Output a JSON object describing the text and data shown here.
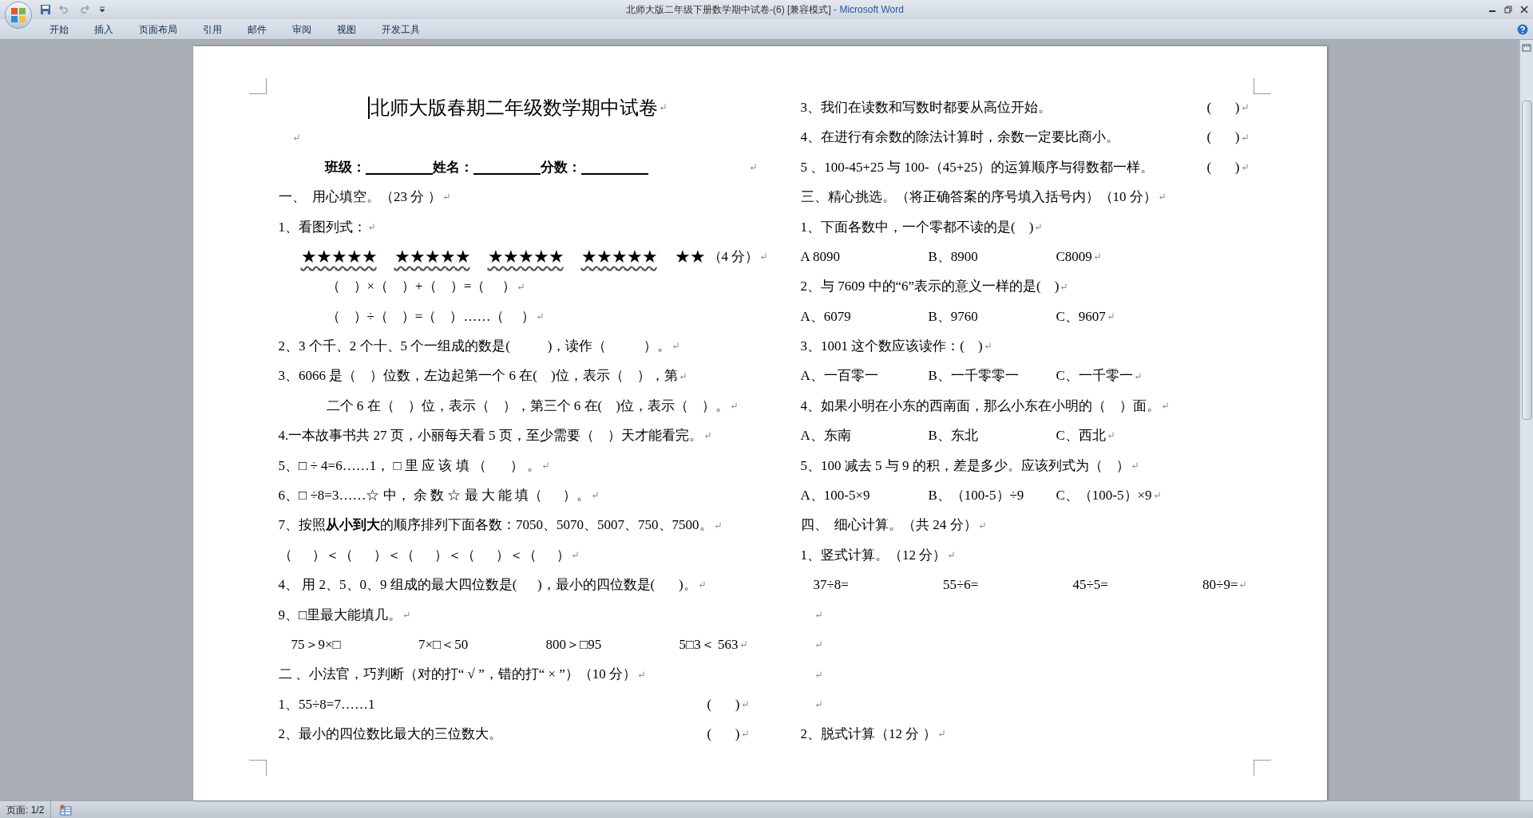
{
  "window": {
    "document_title": "北师大版二年级下册数学期中试卷-(6) [兼容模式]",
    "app_title": " - Microsoft Word"
  },
  "ribbon_tabs": [
    {
      "label": "开始",
      "selected": false
    },
    {
      "label": "插入",
      "selected": false
    },
    {
      "label": "页面布局",
      "selected": false
    },
    {
      "label": "引用",
      "selected": false
    },
    {
      "label": "邮件",
      "selected": false
    },
    {
      "label": "审阅",
      "selected": false
    },
    {
      "label": "视图",
      "selected": false
    },
    {
      "label": "开发工具",
      "selected": false
    }
  ],
  "document": {
    "left_column": [
      {
        "kind": "title",
        "text": "北师大版春期二年级数学期中试卷"
      },
      {
        "kind": "blank"
      },
      {
        "kind": "fields",
        "fields": [
          {
            "label": "班级："
          },
          {
            "label": "姓名："
          },
          {
            "label": "分数："
          }
        ]
      },
      {
        "kind": "text",
        "text": "一、  用心填空。（23 分 ）"
      },
      {
        "kind": "text",
        "text": "1、看图列式："
      },
      {
        "kind": "stars",
        "groups": [
          {
            "text": "★★★★★",
            "flagged": true
          },
          {
            "text": "★★★★★",
            "flagged": true
          },
          {
            "text": "★★★★★",
            "flagged": true
          },
          {
            "text": "★★★★★",
            "flagged": true
          },
          {
            "text": "★★",
            "flagged": false
          }
        ],
        "note": "（4 分）"
      },
      {
        "kind": "indented",
        "text": "（    ）×（    ）+（    ）=（     ）"
      },
      {
        "kind": "indented",
        "text": "（    ）÷（    ）=（    ）……（     ）"
      },
      {
        "kind": "text",
        "text": "2、3 个千、2 个十、5 个一组成的数是(           )，读作（           ）。"
      },
      {
        "kind": "text",
        "text": "3、6066 是（    ）位数，左边起第一个 6 在(    )位，表示（    ），第"
      },
      {
        "kind": "indented",
        "text": "二个 6 在（    ）位，表示（    ），第三个 6 在(    )位，表示（    ）。"
      },
      {
        "kind": "text",
        "text": "4.一本故事书共 27 页，小丽每天看 5 页，至少需要（    ）天才能看完。"
      },
      {
        "kind": "text",
        "text": "5、□ ÷ 4=6……1， □ 里 应 该 填 （       ） 。"
      },
      {
        "kind": "text",
        "text": "6、□ ÷8=3……☆ 中， 余 数 ☆ 最 大 能 填（      ）。"
      },
      {
        "kind": "text",
        "text": "7、按照**从小到大**的顺序排列下面各数：7050、5070、5007、750、7500。"
      },
      {
        "kind": "text",
        "text": "（      ）＜（      ）＜（      ）＜（      ）＜（      ）"
      },
      {
        "kind": "text",
        "text": "4、 用 2、5、0、9 组成的最大四位数是(      )，最小的四位数是(       )。"
      },
      {
        "kind": "text",
        "text": "9、□里最大能填几。"
      },
      {
        "kind": "cells",
        "items": [
          "75＞9×□",
          "7×□＜50",
          "800＞□95",
          "5□3＜ 563"
        ]
      },
      {
        "kind": "text",
        "text": "二 、小法官，巧判断（对的打“ √ ”，错的打“ × ”）（10 分）"
      },
      {
        "kind": "judge",
        "text": "1、55÷8=7……1",
        "answer": "(       )"
      },
      {
        "kind": "judge",
        "text": "2、最小的四位数比最大的三位数大。",
        "answer": "(       )"
      }
    ],
    "right_column": [
      {
        "kind": "judge",
        "text": "3、我们在读数和写数时都要从高位开始。",
        "answer": "(       )"
      },
      {
        "kind": "judge",
        "text": "4、在进行有余数的除法计算时，余数一定要比商小。",
        "answer": "(       )"
      },
      {
        "kind": "judge",
        "text": "5 、100-45+25 与 100-（45+25）的运算顺序与得数都一样。",
        "answer": "(       )"
      },
      {
        "kind": "text",
        "text": "三、精心挑选。（将正确答案的序号填入括号内）（10 分）"
      },
      {
        "kind": "text",
        "text": "1、下面各数中，一个零都不读的是(    )"
      },
      {
        "kind": "options",
        "items": [
          "A 8090",
          "B、8900",
          "C8009"
        ]
      },
      {
        "kind": "text",
        "text": "2、与 7609 中的“6”表示的意义一样的是(    )"
      },
      {
        "kind": "options",
        "items": [
          "A、6079",
          "B、9760",
          "C、9607"
        ]
      },
      {
        "kind": "text",
        "text": "3、1001 这个数应该读作：(    )"
      },
      {
        "kind": "options",
        "items": [
          "A、一百零一",
          "B、一千零零一",
          "C、一千零一"
        ]
      },
      {
        "kind": "text",
        "text": "4、如果小明在小东的西南面，那么小东在小明的（    ）面。"
      },
      {
        "kind": "options",
        "items": [
          "A、东南",
          "B、东北",
          "C、西北"
        ]
      },
      {
        "kind": "text",
        "text": "5、100 减去 5 与 9 的积，差是多少。应该列式为（    ）"
      },
      {
        "kind": "options",
        "items": [
          "A、100-5×9",
          "B、（100-5）÷9",
          "C、（100-5）×9"
        ]
      },
      {
        "kind": "text",
        "text": "四、  细心计算。（共 24 分）"
      },
      {
        "kind": "text",
        "text": "1、竖式计算。（12 分）"
      },
      {
        "kind": "cells",
        "items": [
          "37÷8=",
          "55÷6=",
          "45÷5=",
          "80÷9="
        ]
      },
      {
        "kind": "blank"
      },
      {
        "kind": "blank"
      },
      {
        "kind": "blank"
      },
      {
        "kind": "blank"
      },
      {
        "kind": "text",
        "text": "2、脱式计算（12 分 ）"
      }
    ]
  },
  "status_bar": {
    "page": "页面: 1/2"
  }
}
